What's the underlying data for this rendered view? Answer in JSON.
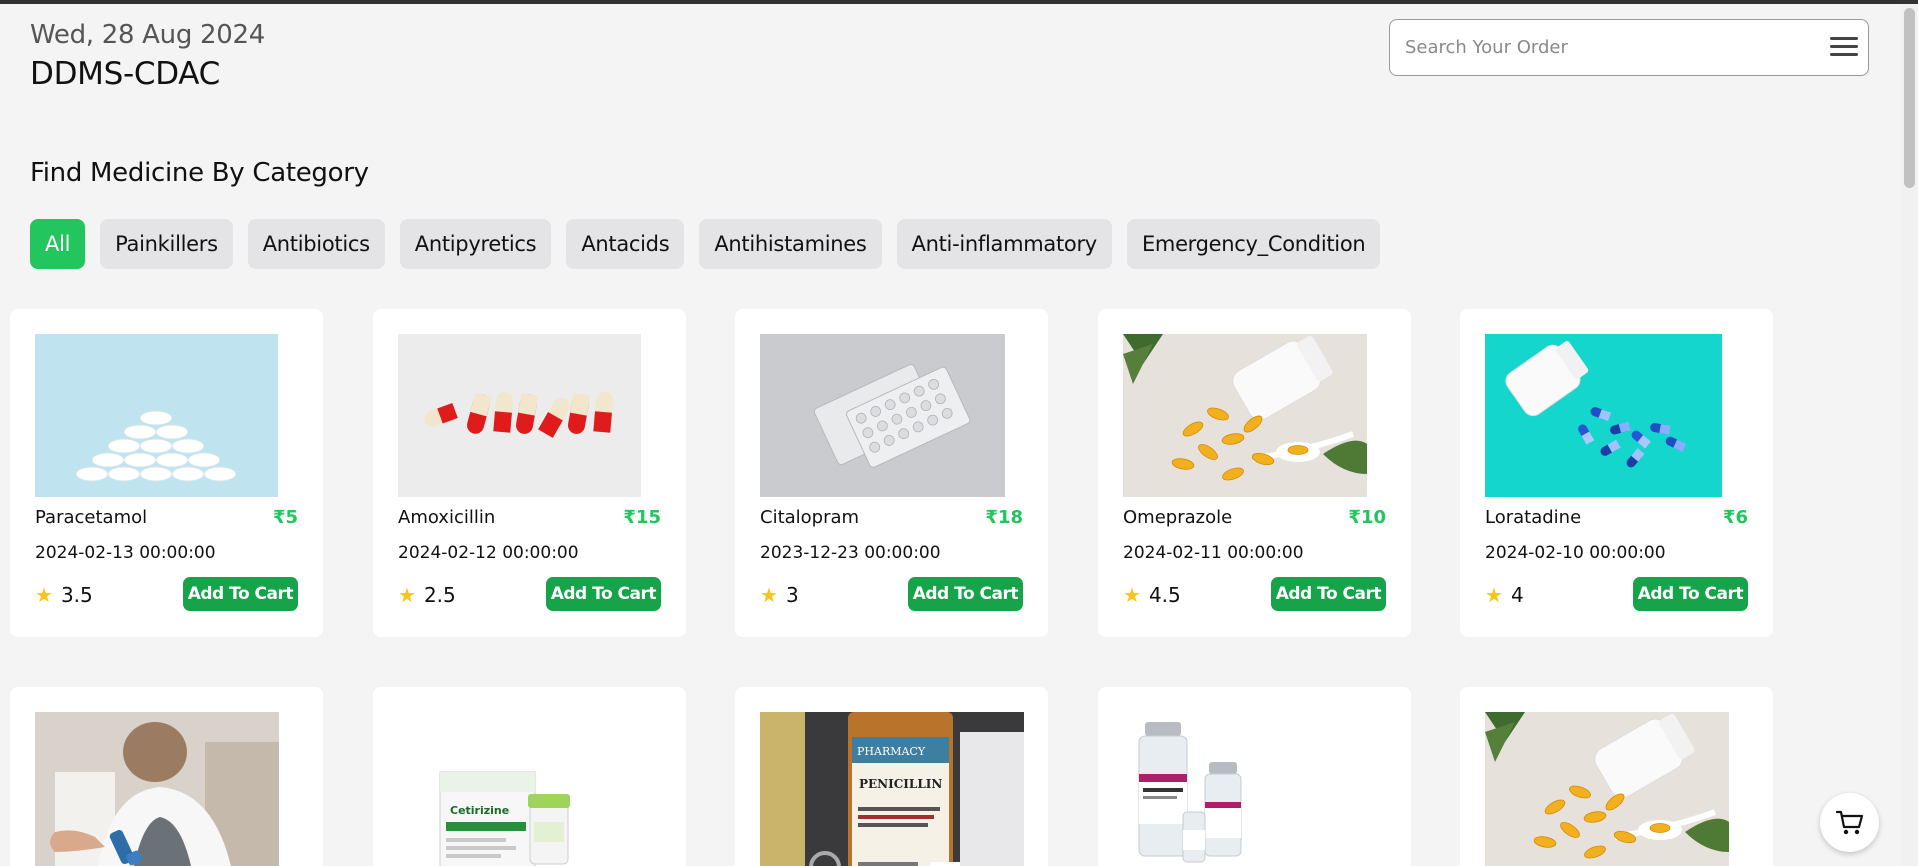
{
  "header": {
    "date": "Wed, 28 Aug 2024",
    "brand": "DDMS-CDAC"
  },
  "search": {
    "placeholder": "Search Your Order",
    "value": ""
  },
  "section_title": "Find Medicine By Category",
  "categories": [
    "All",
    "Painkillers",
    "Antibiotics",
    "Antipyretics",
    "Antacids",
    "Antihistamines",
    "Anti-inflammatory",
    "Emergency_Condition"
  ],
  "active_category": "All",
  "cart_button_label": "Add To Cart",
  "products": [
    {
      "name": "Paracetamol",
      "price": "₹5",
      "date": "2024-02-13 00:00:00",
      "rating": "3.5"
    },
    {
      "name": "Amoxicillin",
      "price": "₹15",
      "date": "2024-02-12 00:00:00",
      "rating": "2.5"
    },
    {
      "name": "Citalopram",
      "price": "₹18",
      "date": "2023-12-23 00:00:00",
      "rating": "3"
    },
    {
      "name": "Omeprazole",
      "price": "₹10",
      "date": "2024-02-11 00:00:00",
      "rating": "4.5"
    },
    {
      "name": "Loratadine",
      "price": "₹6",
      "date": "2024-02-10 00:00:00",
      "rating": "4"
    }
  ],
  "colors": {
    "accent": "#22c55e",
    "button": "#16a34a",
    "star": "#f5c518",
    "page_bg": "#f4f4f4"
  },
  "icons": {
    "menu": "hamburger-icon",
    "star": "star-icon",
    "cart": "cart-icon"
  }
}
